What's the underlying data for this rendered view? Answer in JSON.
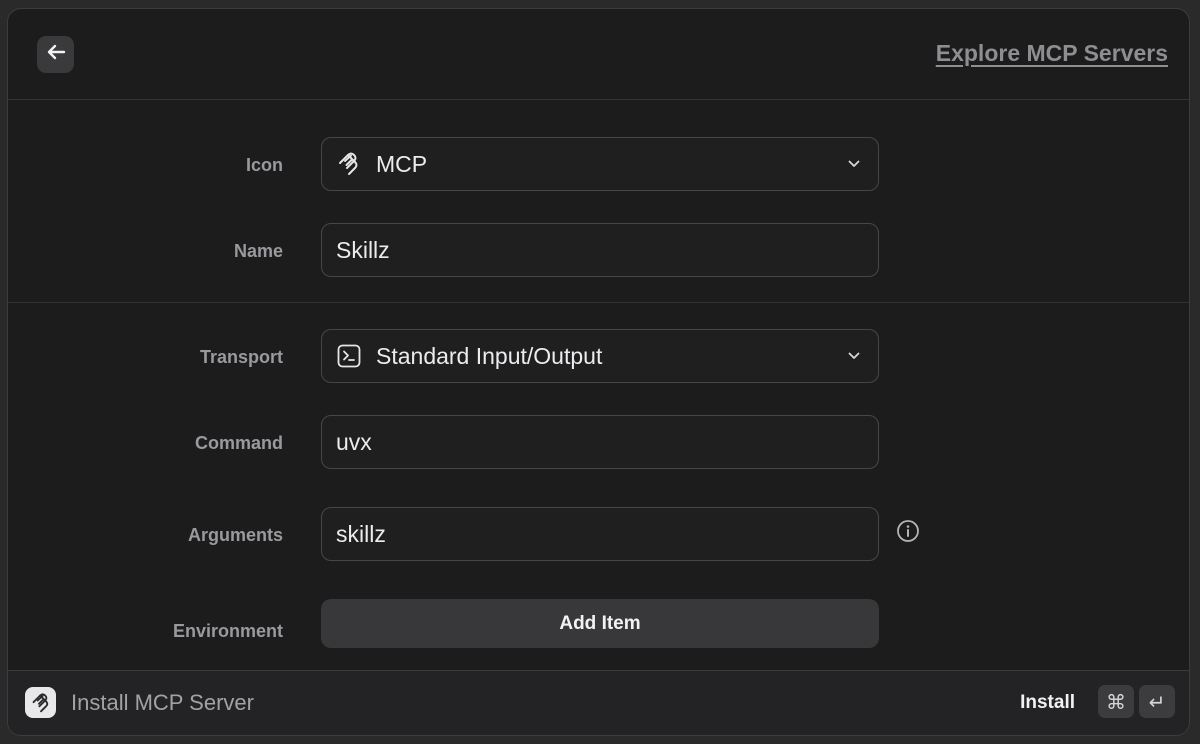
{
  "header": {
    "back_icon": "arrow-left-icon",
    "explore_link": "Explore MCP Servers"
  },
  "form": {
    "icon": {
      "label": "Icon",
      "value": "MCP",
      "icon": "mcp-logo-icon"
    },
    "name": {
      "label": "Name",
      "value": "Skillz"
    },
    "transport": {
      "label": "Transport",
      "value": "Standard Input/Output",
      "icon": "terminal-icon"
    },
    "command": {
      "label": "Command",
      "value": "uvx"
    },
    "arguments": {
      "label": "Arguments",
      "value": "skillz",
      "info_icon": "info-icon"
    },
    "environment": {
      "label": "Environment",
      "button": "Add Item"
    }
  },
  "footer": {
    "title": "Install MCP Server",
    "action": "Install",
    "shortcut_keys": [
      "⌘",
      "↵"
    ]
  },
  "colors": {
    "background": "#1c1c1d",
    "field_border": "#47474a",
    "label": "#9a9a9e",
    "text": "#ececee"
  }
}
